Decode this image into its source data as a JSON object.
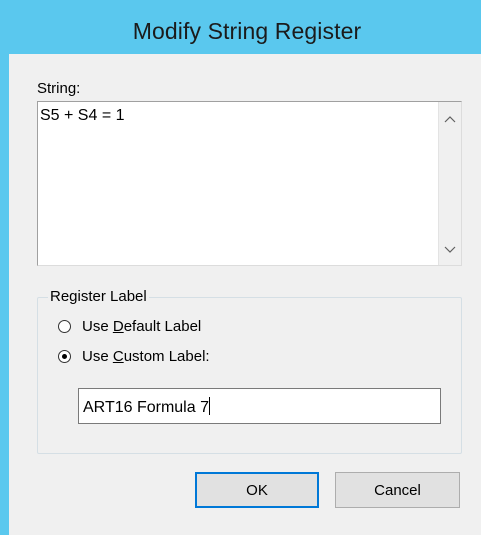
{
  "window": {
    "title": "Modify String Register"
  },
  "string_field": {
    "label": "String:",
    "value": "S5 + S4 = 1"
  },
  "register_label_group": {
    "legend": "Register Label",
    "options": [
      {
        "prefix": "Use ",
        "accel": "D",
        "suffix": "efault Label",
        "selected": false
      },
      {
        "prefix": "Use ",
        "accel": "C",
        "suffix": "ustom Label:",
        "selected": true
      }
    ],
    "custom_value": "ART16 Formula 7"
  },
  "buttons": {
    "ok": "OK",
    "cancel": "Cancel"
  },
  "colors": {
    "titlebar": "#5ac8ee",
    "client": "#f0f0f0",
    "default_button_border": "#0078d7"
  },
  "icons": {
    "scroll_up": "chevron-up-icon",
    "scroll_down": "chevron-down-icon"
  }
}
